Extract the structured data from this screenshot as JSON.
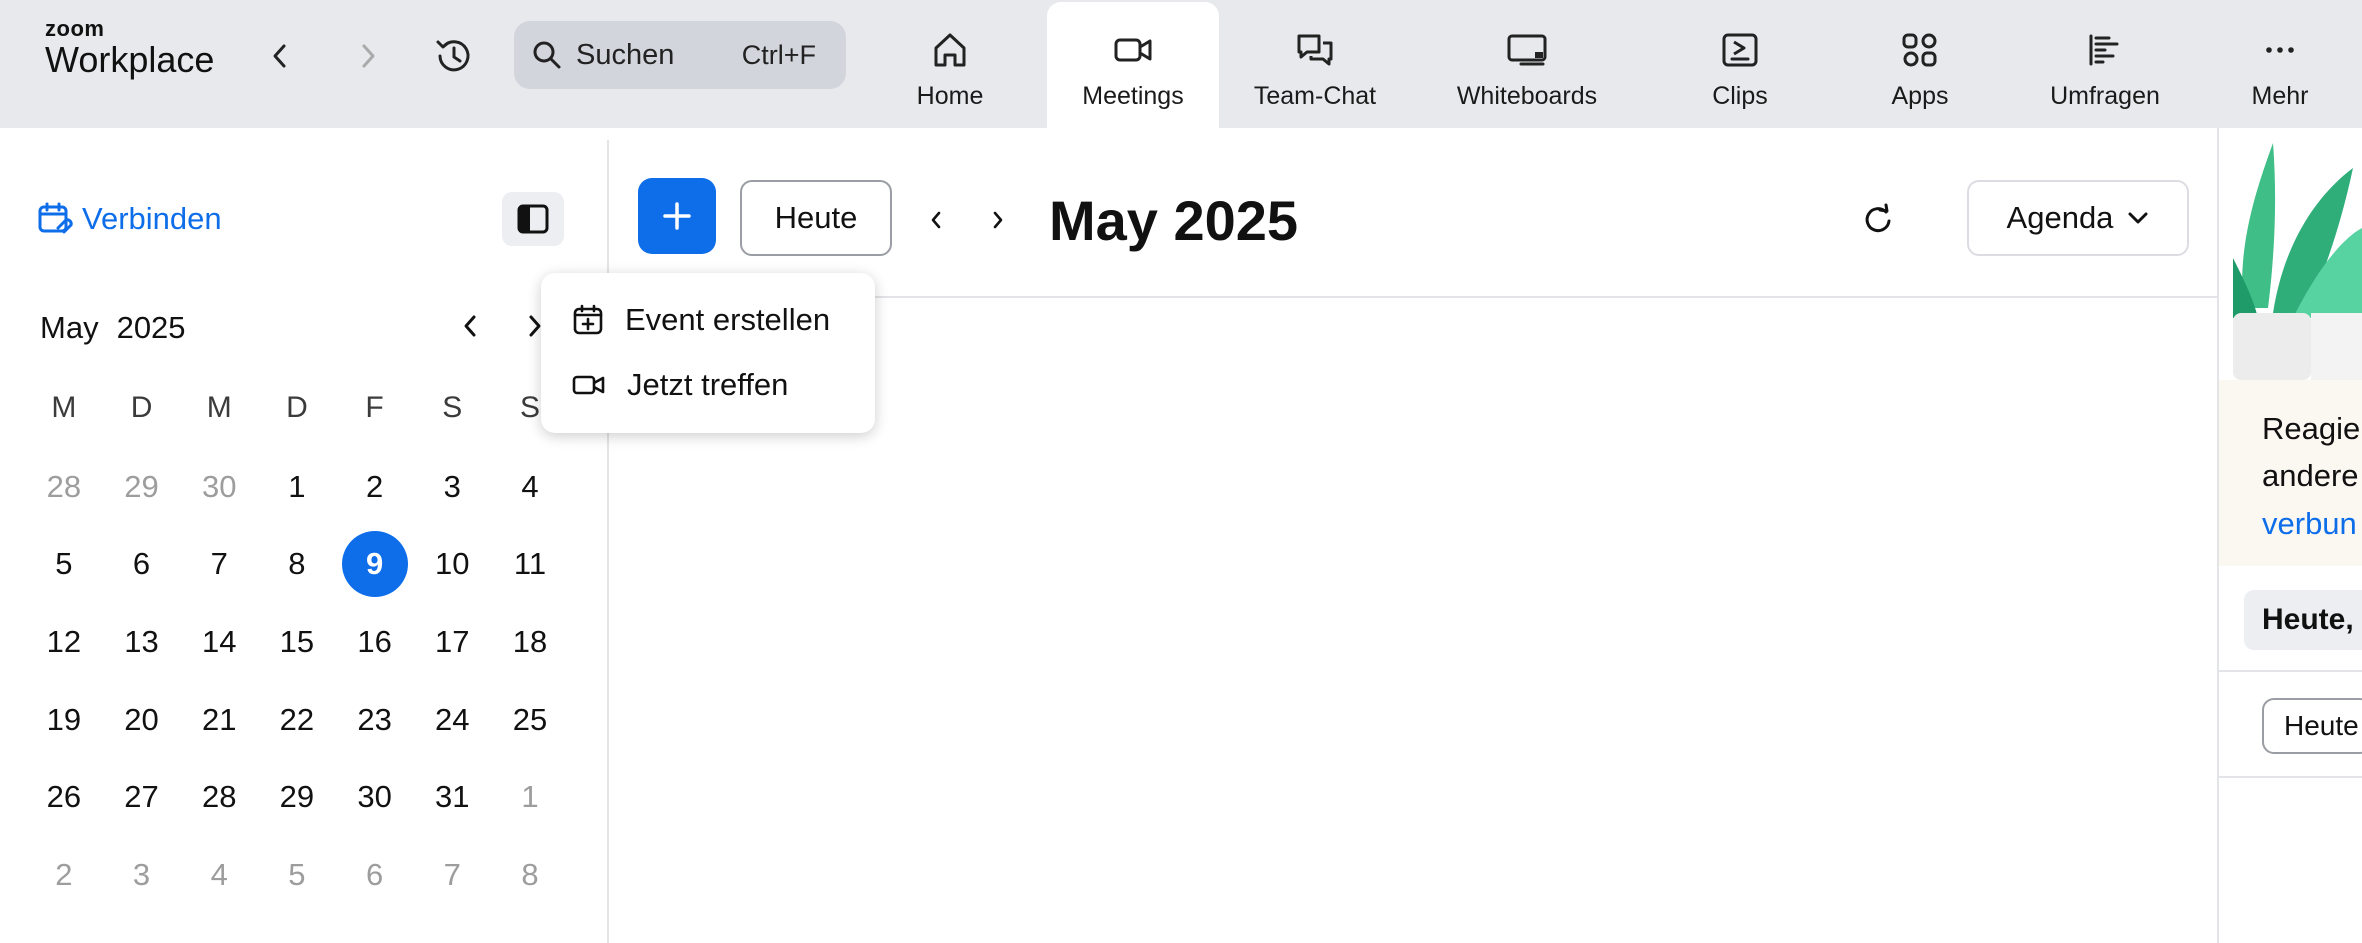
{
  "app": {
    "logo_top": "zoom",
    "logo_bottom": "Workplace"
  },
  "topbar": {
    "search_label": "Suchen",
    "search_shortcut": "Ctrl+F",
    "tabs": [
      {
        "label": "Home",
        "icon": "home-icon"
      },
      {
        "label": "Meetings",
        "icon": "video-camera-icon",
        "active": true
      },
      {
        "label": "Team-Chat",
        "icon": "chat-bubbles-icon"
      },
      {
        "label": "Whiteboards",
        "icon": "whiteboard-icon"
      },
      {
        "label": "Clips",
        "icon": "clips-icon"
      },
      {
        "label": "Apps",
        "icon": "apps-icon"
      },
      {
        "label": "Umfragen",
        "icon": "survey-icon"
      },
      {
        "label": "Mehr",
        "icon": "more-dots-icon"
      }
    ]
  },
  "sidebar": {
    "connect_label": "Verbinden",
    "mini_calendar": {
      "month": "May",
      "year": "2025",
      "weekdays": [
        "M",
        "D",
        "M",
        "D",
        "F",
        "S",
        "S"
      ],
      "weeks": [
        [
          {
            "d": "28",
            "o": true
          },
          {
            "d": "29",
            "o": true
          },
          {
            "d": "30",
            "o": true
          },
          {
            "d": "1"
          },
          {
            "d": "2"
          },
          {
            "d": "3"
          },
          {
            "d": "4"
          }
        ],
        [
          {
            "d": "5"
          },
          {
            "d": "6"
          },
          {
            "d": "7"
          },
          {
            "d": "8"
          },
          {
            "d": "9",
            "today": true
          },
          {
            "d": "10"
          },
          {
            "d": "11"
          }
        ],
        [
          {
            "d": "12"
          },
          {
            "d": "13"
          },
          {
            "d": "14"
          },
          {
            "d": "15"
          },
          {
            "d": "16"
          },
          {
            "d": "17"
          },
          {
            "d": "18"
          }
        ],
        [
          {
            "d": "19"
          },
          {
            "d": "20"
          },
          {
            "d": "21"
          },
          {
            "d": "22"
          },
          {
            "d": "23"
          },
          {
            "d": "24"
          },
          {
            "d": "25"
          }
        ],
        [
          {
            "d": "26"
          },
          {
            "d": "27"
          },
          {
            "d": "28"
          },
          {
            "d": "29"
          },
          {
            "d": "30"
          },
          {
            "d": "31"
          },
          {
            "d": "1",
            "o": true
          }
        ],
        [
          {
            "d": "2",
            "o": true
          },
          {
            "d": "3",
            "o": true
          },
          {
            "d": "4",
            "o": true
          },
          {
            "d": "5",
            "o": true
          },
          {
            "d": "6",
            "o": true
          },
          {
            "d": "7",
            "o": true
          },
          {
            "d": "8",
            "o": true
          }
        ]
      ]
    }
  },
  "main": {
    "today_button": "Heute",
    "month_title": "May 2025",
    "view_select": "Agenda"
  },
  "dropdown": {
    "items": [
      {
        "label": "Event erstellen",
        "icon": "calendar-add-icon"
      },
      {
        "label": "Jetzt treffen",
        "icon": "video-camera-icon"
      }
    ]
  },
  "right_panel": {
    "promo_lines": [
      "Reagie",
      "andere",
      "verbun"
    ],
    "today_header": "Heute,",
    "today_chip": "Heute"
  },
  "colors": {
    "accent": "#0e6ee9",
    "topbar_bg": "#e8e9ed"
  }
}
